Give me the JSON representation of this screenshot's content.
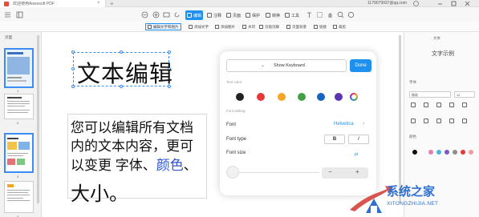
{
  "window": {
    "tab_title": "欢迎使用Aiseesoft PDF",
    "account": "1179079937@qq.com"
  },
  "toolbar": {
    "items": [
      {
        "label": "编辑",
        "icon": "edit-icon",
        "active": true
      },
      {
        "label": "注释",
        "icon": "comment-icon",
        "active": false
      },
      {
        "label": "页面",
        "icon": "page-icon",
        "active": false
      },
      {
        "label": "保护",
        "icon": "protect-icon",
        "active": false
      },
      {
        "label": "转换",
        "icon": "convert-icon",
        "active": false
      },
      {
        "label": "工具",
        "icon": "tools-icon",
        "active": false
      }
    ]
  },
  "subtoolbar": {
    "items": [
      {
        "label": "编辑文字和图片",
        "active": true
      },
      {
        "label": "添加文字",
        "active": false
      },
      {
        "label": "添加图片",
        "active": false
      },
      {
        "label": "水印",
        "active": false
      },
      {
        "label": "页眉页脚",
        "active": false
      },
      {
        "label": "页面背景",
        "active": false
      },
      {
        "label": "链接",
        "active": false
      },
      {
        "label": "裁剪",
        "active": false
      }
    ]
  },
  "sidebar": {
    "title": "页面",
    "pages": [
      "1",
      "2",
      "3",
      "4"
    ]
  },
  "document": {
    "heading": "文本编辑",
    "body_lines": [
      "您可以编辑所有文档",
      "内的文本内容，更可"
    ],
    "line3_prefix": "以变更 字体、",
    "line3_blue": "颜色",
    "line3_suffix": "、",
    "big_line": "大小。"
  },
  "popup": {
    "keyboard_label": "Show Keyboard",
    "done_label": "Done",
    "text_color_label": "Text color",
    "colors": [
      "#222222",
      "#e53935",
      "#f5a623",
      "#43a047",
      "#1565c0",
      "#5e35b1"
    ],
    "font_setting_label": "Font setting",
    "font_label": "Font",
    "font_value": "Helvetica",
    "font_type_label": "Font type",
    "bold_label": "B",
    "italic_label": "I",
    "font_size_label": "Font size",
    "size_unit": "pt",
    "minus_label": "−",
    "plus_label": "+"
  },
  "rightpanel": {
    "title": "文本",
    "preview": "文字示例",
    "font_label": "字体",
    "font_value": "微软",
    "size_value": "12",
    "color_label": "颜色",
    "colors": [
      "#111111",
      "#e57fb0",
      "#4db6d4",
      "#7e57c2",
      "#8d8d8d",
      "#e53935",
      "#f29b9b"
    ]
  },
  "watermark": {
    "brand": "系统之家",
    "url": "XITONGZHIJIA.NET"
  }
}
